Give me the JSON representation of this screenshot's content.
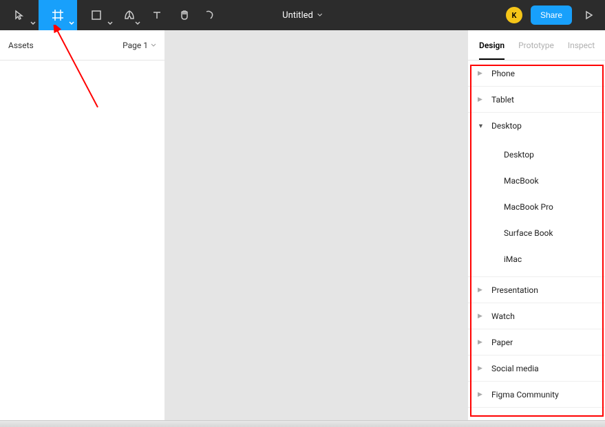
{
  "toolbar": {
    "title": "Untitled",
    "avatar_initial": "K",
    "share_label": "Share"
  },
  "left_panel": {
    "tab_assets": "Assets",
    "page_label": "Page 1"
  },
  "right_panel": {
    "tabs": {
      "design": "Design",
      "prototype": "Prototype",
      "inspect": "Inspect"
    },
    "presets": {
      "phone": "Phone",
      "tablet": "Tablet",
      "desktop": {
        "label": "Desktop",
        "children": [
          "Desktop",
          "MacBook",
          "MacBook Pro",
          "Surface Book",
          "iMac"
        ]
      },
      "presentation": "Presentation",
      "watch": "Watch",
      "paper": "Paper",
      "social": "Social media",
      "community": "Figma Community"
    }
  }
}
